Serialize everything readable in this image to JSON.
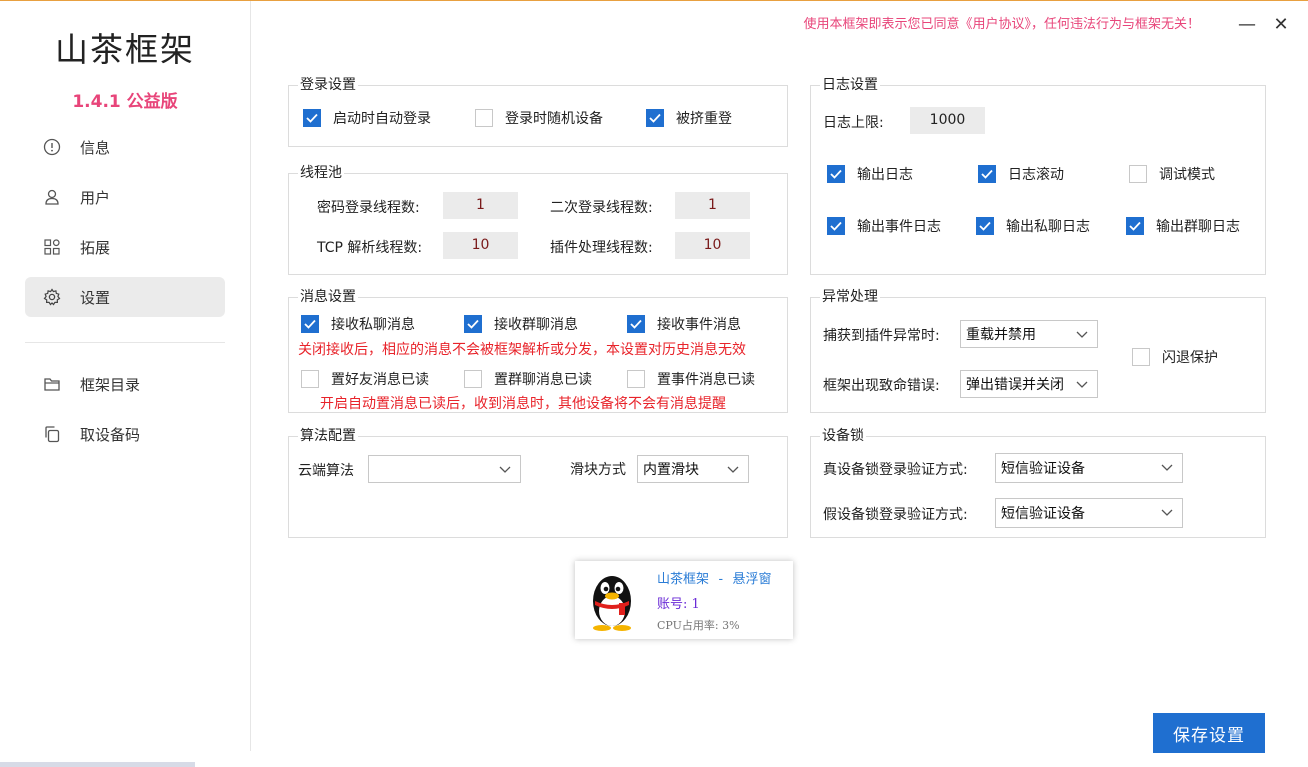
{
  "sidebar": {
    "app_title": "山茶框架",
    "version": "1.4.1 公益版",
    "items": [
      {
        "label": "信息",
        "icon": "info-circle-icon"
      },
      {
        "label": "用户",
        "icon": "user-icon"
      },
      {
        "label": "拓展",
        "icon": "grid-icon"
      },
      {
        "label": "设置",
        "icon": "gear-icon"
      },
      {
        "label": "框架目录",
        "icon": "folder-icon"
      },
      {
        "label": "取设备码",
        "icon": "copy-icon"
      }
    ],
    "active_index": 3
  },
  "header": {
    "notice": "使用本框架即表示您已同意《用户协议》，任何违法行为与框架无关！",
    "minimize": "—",
    "close": "✕"
  },
  "login": {
    "title": "登录设置",
    "options": [
      {
        "label": "启动时自动登录",
        "checked": true
      },
      {
        "label": "登录时随机设备",
        "checked": false
      },
      {
        "label": "被挤重登",
        "checked": true
      }
    ]
  },
  "threadpool": {
    "title": "线程池",
    "pwd_login_label": "密码登录线程数:",
    "pwd_login_value": "1",
    "second_login_label": "二次登录线程数:",
    "second_login_value": "1",
    "tcp_label": "TCP 解析线程数:",
    "tcp_value": "10",
    "plugin_label": "插件处理线程数:",
    "plugin_value": "10"
  },
  "message": {
    "title": "消息设置",
    "receive": [
      {
        "label": "接收私聊消息",
        "checked": true
      },
      {
        "label": "接收群聊消息",
        "checked": true
      },
      {
        "label": "接收事件消息",
        "checked": true
      }
    ],
    "warn1": "关闭接收后，相应的消息不会被框架解析或分发，本设置对历史消息无效",
    "read": [
      {
        "label": "置好友消息已读",
        "checked": false
      },
      {
        "label": "置群聊消息已读",
        "checked": false
      },
      {
        "label": "置事件消息已读",
        "checked": false
      }
    ],
    "warn2": "开启自动置消息已读后，收到消息时，其他设备将不会有消息提醒"
  },
  "algorithm": {
    "title": "算法配置",
    "cloud_label": "云端算法",
    "cloud_value": "",
    "slider_label": "滑块方式",
    "slider_value": "内置滑块"
  },
  "log": {
    "title": "日志设置",
    "limit_label": "日志上限:",
    "limit_value": "1000",
    "options": [
      {
        "label": "输出日志",
        "checked": true
      },
      {
        "label": "日志滚动",
        "checked": true
      },
      {
        "label": "调试模式",
        "checked": false
      },
      {
        "label": "输出事件日志",
        "checked": true
      },
      {
        "label": "输出私聊日志",
        "checked": true
      },
      {
        "label": "输出群聊日志",
        "checked": true
      }
    ]
  },
  "exception": {
    "title": "异常处理",
    "plugin_label": "捕获到插件异常时:",
    "plugin_value": "重载并禁用",
    "fatal_label": "框架出现致命错误:",
    "fatal_value": "弹出错误并关闭",
    "crash_label": "闪退保护",
    "crash_checked": false
  },
  "device_lock": {
    "title": "设备锁",
    "real_label": "真设备锁登录验证方式:",
    "real_value": "短信验证设备",
    "fake_label": "假设备锁登录验证方式:",
    "fake_value": "短信验证设备"
  },
  "float_window": {
    "title": "山茶框架 - 悬浮窗",
    "account": "账号: 1",
    "cpu": "CPU占用率: 3%"
  },
  "save_label": "保存设置",
  "colors": {
    "accent": "#1f6fd0",
    "warning": "#e8232a",
    "pink": "#e8457a"
  }
}
